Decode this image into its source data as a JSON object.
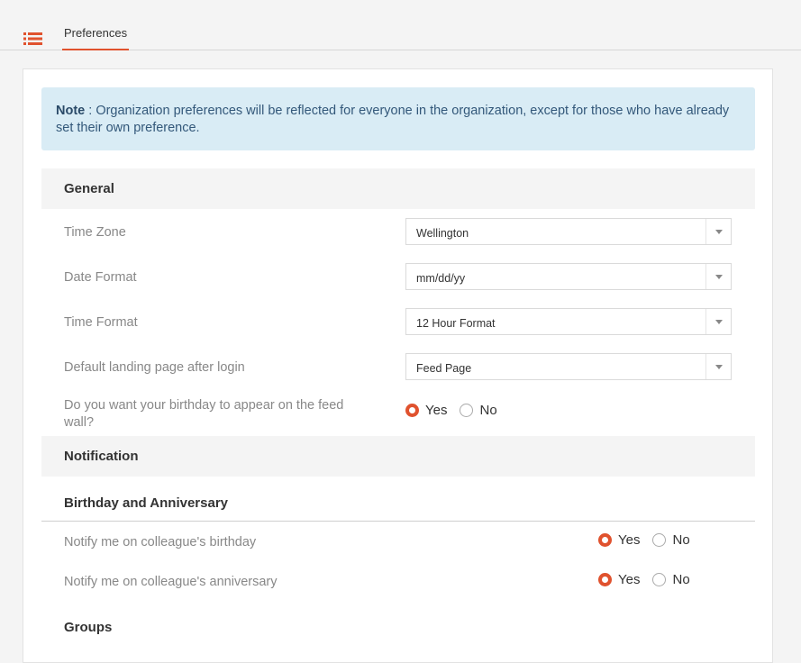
{
  "tabs": {
    "preferences_label": "Preferences"
  },
  "note": {
    "prefix": "Note",
    "text": " : Organization preferences will be reflected for everyone in the organization, except for those who have already set their own preference."
  },
  "general": {
    "title": "General",
    "time_zone": {
      "label": "Time Zone",
      "value": "Wellington"
    },
    "date_format": {
      "label": "Date Format",
      "value": "mm/dd/yy"
    },
    "time_format": {
      "label": "Time Format",
      "value": "12 Hour Format"
    },
    "landing_page": {
      "label": "Default landing page after login",
      "value": "Feed Page"
    },
    "birthday_wall": {
      "label": "Do you want your birthday to appear on the feed wall?",
      "yes": "Yes",
      "no": "No",
      "selected": "Yes"
    }
  },
  "notification": {
    "title": "Notification",
    "birthday_anniversary": {
      "title": "Birthday and Anniversary",
      "birthday": {
        "label": "Notify me on colleague's birthday",
        "yes": "Yes",
        "no": "No",
        "selected": "Yes"
      },
      "anniversary": {
        "label": "Notify me on colleague's anniversary",
        "yes": "Yes",
        "no": "No",
        "selected": "Yes"
      }
    },
    "groups": {
      "title": "Groups"
    }
  },
  "colors": {
    "accent": "#e0522e",
    "note_bg": "#d9ecf5",
    "section_bg": "#f4f4f4"
  }
}
